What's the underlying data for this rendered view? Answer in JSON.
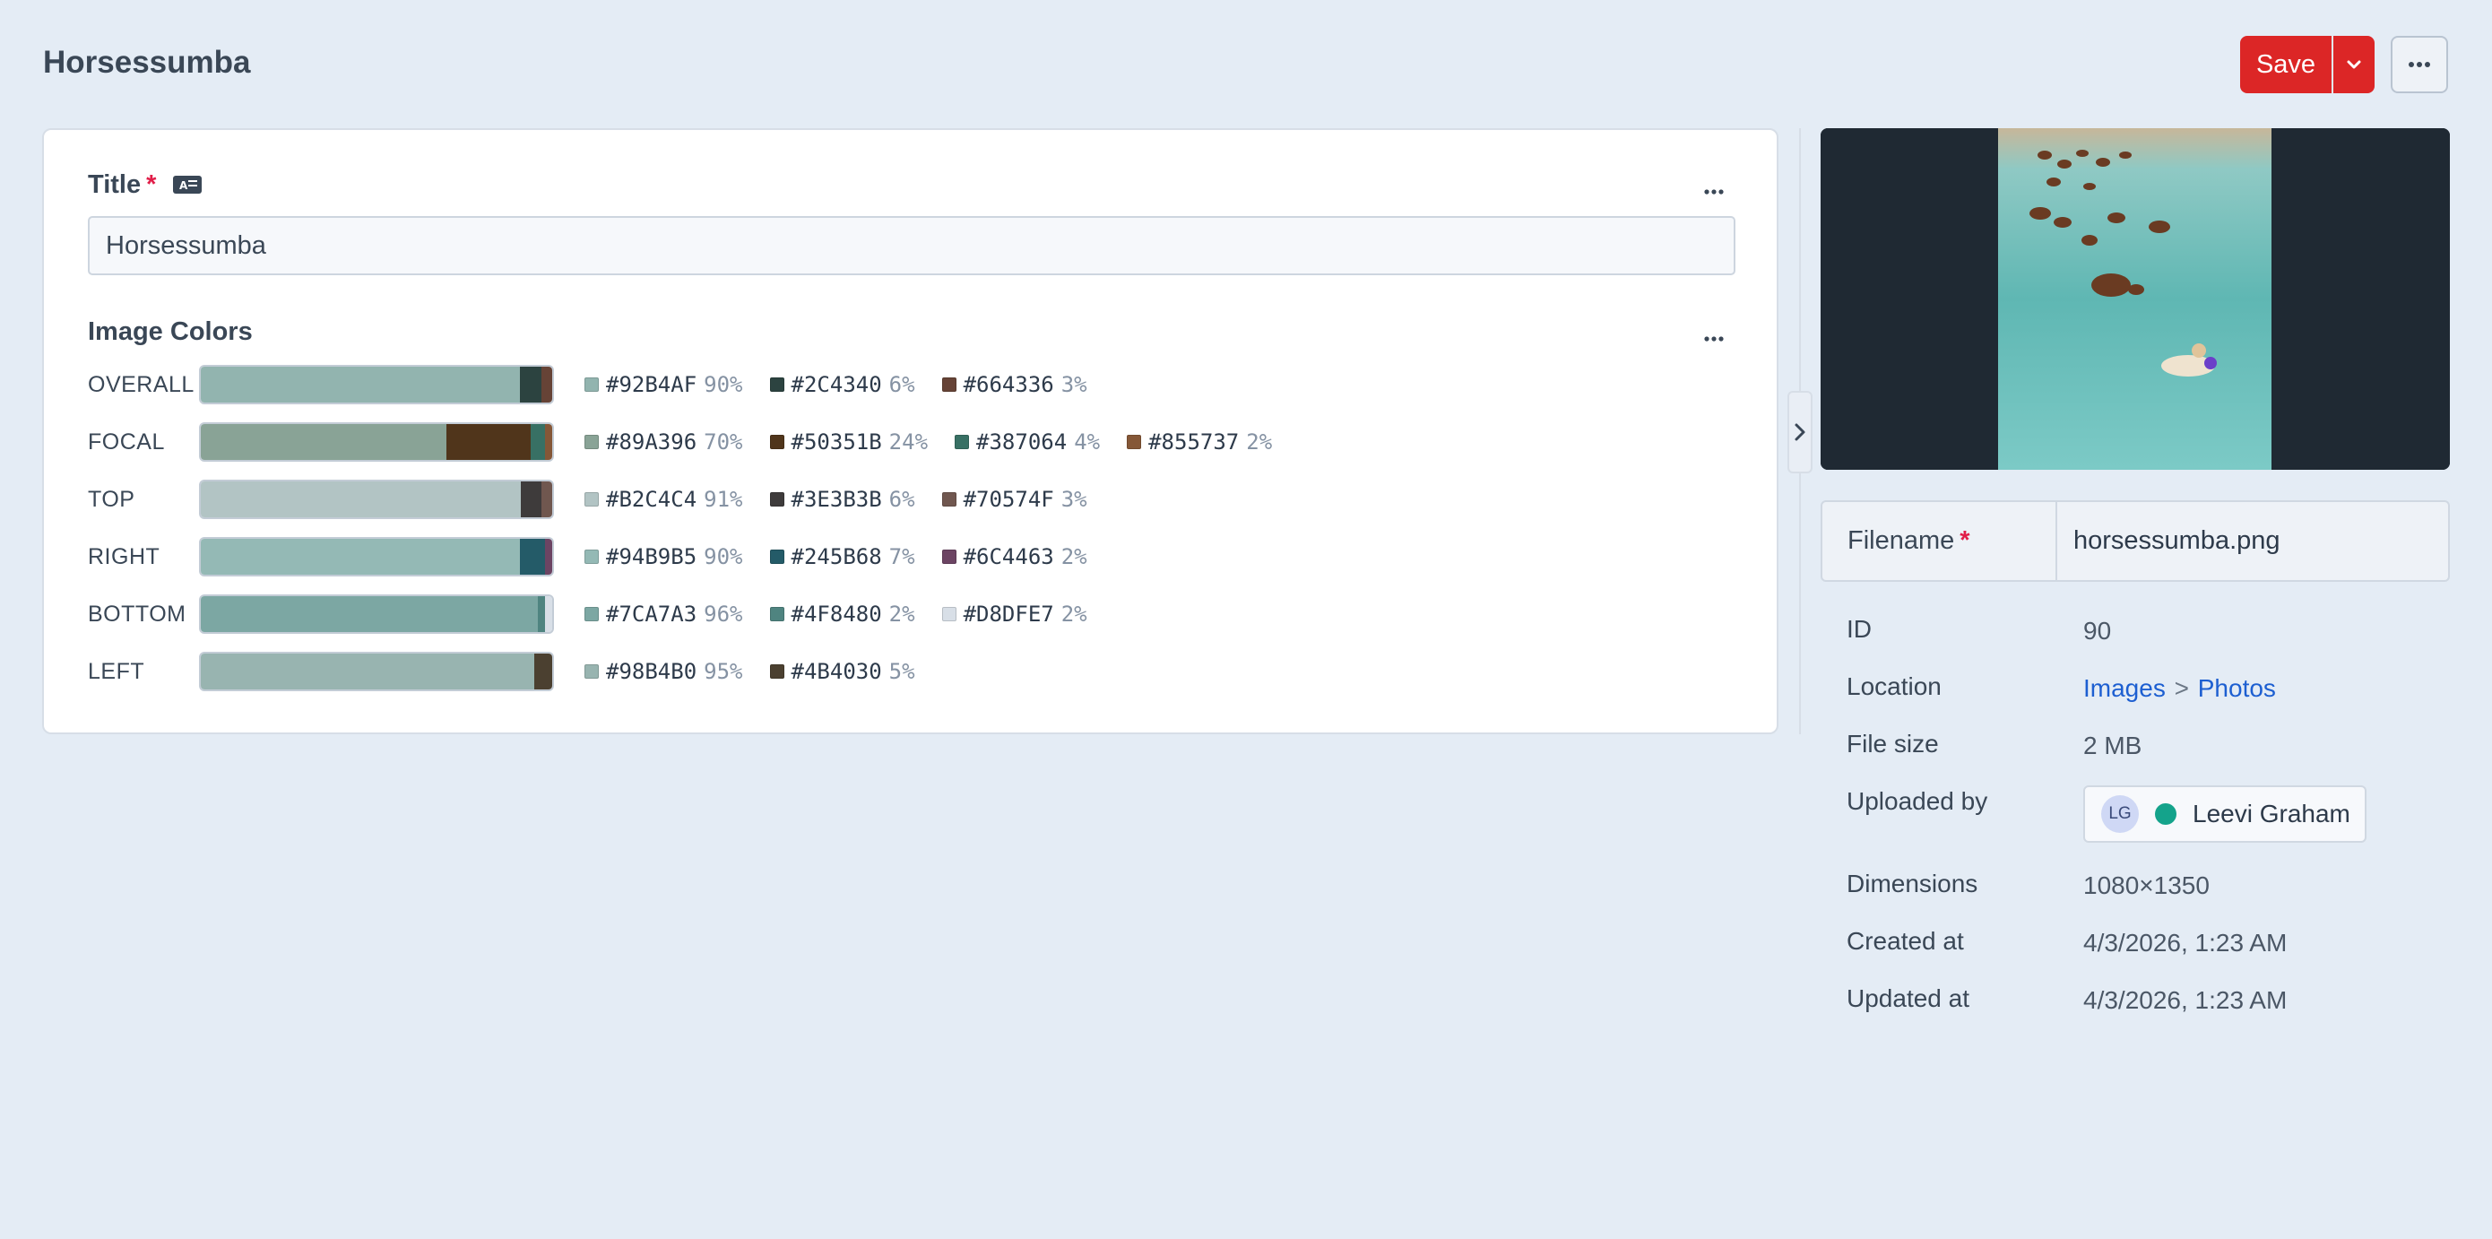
{
  "header": {
    "title": "Horsessumba",
    "save_label": "Save"
  },
  "title_field": {
    "label": "Title",
    "required_mark": "*",
    "value": "Horsessumba"
  },
  "image_colors": {
    "label": "Image Colors",
    "rows": [
      {
        "name": "OVERALL",
        "swatches": [
          {
            "hex": "#92B4AF",
            "pct": "90%"
          },
          {
            "hex": "#2C4340",
            "pct": "6%"
          },
          {
            "hex": "#664336",
            "pct": "3%"
          }
        ]
      },
      {
        "name": "FOCAL",
        "swatches": [
          {
            "hex": "#89A396",
            "pct": "70%"
          },
          {
            "hex": "#50351B",
            "pct": "24%"
          },
          {
            "hex": "#387064",
            "pct": "4%"
          },
          {
            "hex": "#855737",
            "pct": "2%"
          }
        ]
      },
      {
        "name": "TOP",
        "swatches": [
          {
            "hex": "#B2C4C4",
            "pct": "91%"
          },
          {
            "hex": "#3E3B3B",
            "pct": "6%"
          },
          {
            "hex": "#70574F",
            "pct": "3%"
          }
        ]
      },
      {
        "name": "RIGHT",
        "swatches": [
          {
            "hex": "#94B9B5",
            "pct": "90%"
          },
          {
            "hex": "#245B68",
            "pct": "7%"
          },
          {
            "hex": "#6C4463",
            "pct": "2%"
          }
        ]
      },
      {
        "name": "BOTTOM",
        "swatches": [
          {
            "hex": "#7CA7A3",
            "pct": "96%"
          },
          {
            "hex": "#4F8480",
            "pct": "2%"
          },
          {
            "hex": "#D8DFE7",
            "pct": "2%"
          }
        ]
      },
      {
        "name": "LEFT",
        "swatches": [
          {
            "hex": "#98B4B0",
            "pct": "95%"
          },
          {
            "hex": "#4B4030",
            "pct": "5%"
          }
        ]
      }
    ]
  },
  "sidebar": {
    "filename": {
      "label": "Filename",
      "required_mark": "*",
      "value": "horsessumba.png"
    },
    "meta": {
      "id_label": "ID",
      "id_value": "90",
      "location_label": "Location",
      "location_parent": "Images",
      "location_sep": ">",
      "location_child": "Photos",
      "size_label": "File size",
      "size_value": "2 MB",
      "uploaded_label": "Uploaded by",
      "uploader_initials": "LG",
      "uploader_name": "Leevi Graham",
      "dimensions_label": "Dimensions",
      "dimensions_value": "1080×1350",
      "created_label": "Created at",
      "created_value": "4/3/2026, 1:23 AM",
      "updated_label": "Updated at",
      "updated_value": "4/3/2026, 1:23 AM"
    }
  }
}
